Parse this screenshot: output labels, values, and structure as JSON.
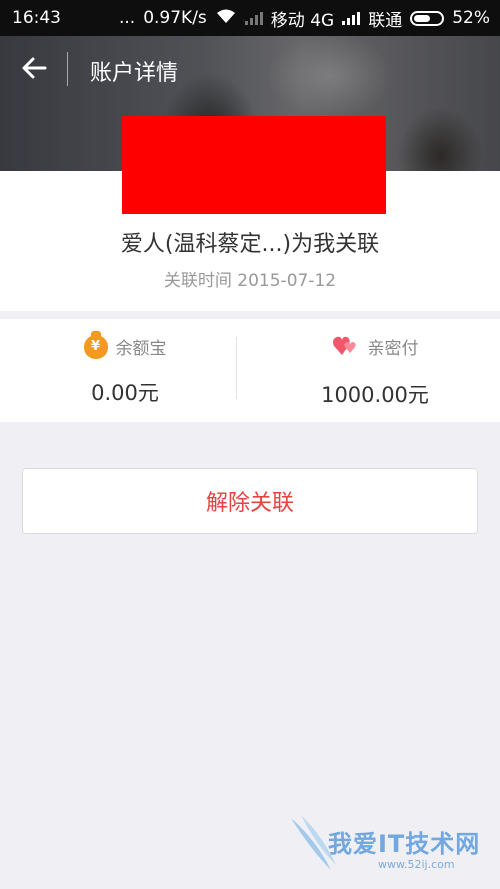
{
  "status_bar": {
    "time": "16:43",
    "dots": "...",
    "speed": "0.97K/s",
    "carrier1": "移动 4G",
    "carrier2": "联通",
    "battery": "52%"
  },
  "header": {
    "title": "账户详情"
  },
  "relation": {
    "text": "爱人(温科蔡定...)为我关联",
    "time": "关联时间 2015-07-12"
  },
  "balances": [
    {
      "icon": "money-bag-icon",
      "icon_glyph": "¥",
      "label": "余额宝",
      "value": "0.00元",
      "color": "#f39a1f"
    },
    {
      "icon": "hearts-icon",
      "label": "亲密付",
      "value": "1000.00元",
      "color": "#f1576b"
    }
  ],
  "actions": {
    "unlink_label": "解除关联"
  },
  "watermark": {
    "text": "我爱IT技术网",
    "url": "www.52ij.com"
  },
  "colors": {
    "accent_red": "#e64340",
    "background": "#efeff4",
    "placeholder_red": "#ff0000"
  }
}
